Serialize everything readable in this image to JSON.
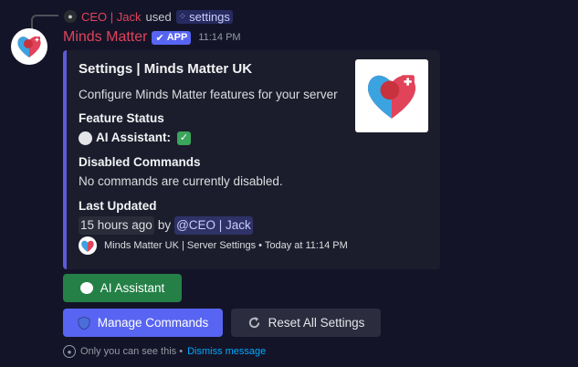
{
  "reply": {
    "user": "CEO | Jack",
    "used_text": "used",
    "command": "settings"
  },
  "message": {
    "bot_name": "Minds Matter",
    "badge": "APP",
    "timestamp": "11:14 PM"
  },
  "embed": {
    "title": "Settings | Minds Matter UK",
    "description": "Configure Minds Matter features for your server",
    "fields": [
      {
        "name": "Feature Status",
        "value_label": "AI Assistant:"
      },
      {
        "name": "Disabled Commands",
        "value": "No commands are currently disabled."
      },
      {
        "name": "Last Updated",
        "value_time": "15 hours ago",
        "value_by": "by",
        "value_mention": "@CEO | Jack"
      }
    ],
    "footer": "Minds Matter UK | Server Settings • Today at 11:14 PM",
    "accent_color": "#5c5ad8"
  },
  "buttons": {
    "ai_assistant": "AI Assistant",
    "manage_commands": "Manage Commands",
    "reset_all": "Reset All Settings"
  },
  "ephemeral": {
    "text": "Only you can see this •",
    "dismiss": "Dismiss message"
  },
  "colors": {
    "background": "#141428",
    "bot_name": "#e0435a",
    "green_button": "#248046",
    "blurple": "#5865f2"
  },
  "icons": [
    "heart-brain-logo-icon",
    "command-icon",
    "check-icon",
    "speech-bubble-icon",
    "shield-icon",
    "refresh-icon",
    "eye-icon"
  ]
}
